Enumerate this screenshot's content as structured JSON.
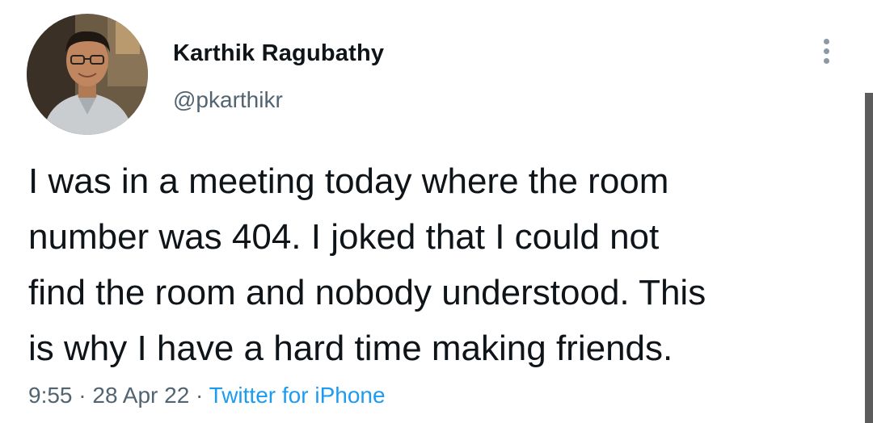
{
  "author": {
    "name": "Karthik Ragubathy",
    "handle": "@pkarthikr"
  },
  "tweet": {
    "lines": [
      "I was in a meeting today where the room",
      "number was 404. I joked that I could not",
      "find the room and nobody understood. This",
      "is why I have a hard time making friends."
    ]
  },
  "meta": {
    "time": "9:55",
    "separator": "·",
    "date": "28 Apr 22",
    "source": "Twitter for iPhone"
  },
  "icons": {
    "more": "more-vertical-icon"
  },
  "colors": {
    "text": "#0f1419",
    "secondary": "#536471",
    "link": "#1d9bf0"
  }
}
